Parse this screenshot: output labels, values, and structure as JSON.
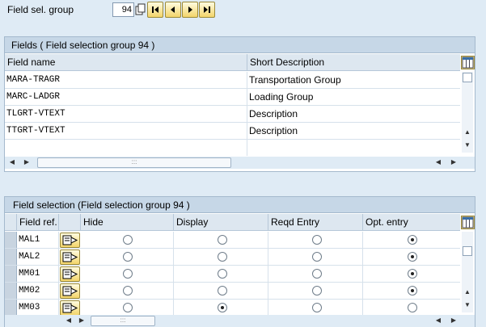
{
  "header": {
    "group_label": "Field sel. group",
    "group_value": "94"
  },
  "fields_table": {
    "title": "Fields  ( Field selection group  94 )",
    "columns": [
      "Field name",
      "Short Description"
    ],
    "rows": [
      {
        "name": "MARA-TRAGR",
        "desc": "Transportation Group"
      },
      {
        "name": "MARC-LADGR",
        "desc": "Loading Group"
      },
      {
        "name": "TLGRT-VTEXT",
        "desc": "Description"
      },
      {
        "name": "TTGRT-VTEXT",
        "desc": "Description"
      }
    ]
  },
  "selection_table": {
    "title": "Field selection (Field selection group  94 )",
    "columns": [
      "Field ref.",
      "Hide",
      "Display",
      "Reqd Entry",
      "Opt. entry"
    ],
    "rows": [
      {
        "ref": "MAL1",
        "selected": "Opt. entry"
      },
      {
        "ref": "MAL2",
        "selected": "Opt. entry"
      },
      {
        "ref": "MM01",
        "selected": "Opt. entry"
      },
      {
        "ref": "MM02",
        "selected": "Opt. entry"
      },
      {
        "ref": "MM03",
        "selected": "Display"
      }
    ]
  },
  "icons": {
    "copy": "copy-icon",
    "first": "first-page-icon",
    "prev": "previous-page-icon",
    "next": "next-page-icon",
    "last": "last-page-icon",
    "config": "table-settings-icon",
    "format": "field-format-icon"
  },
  "colors": {
    "background": "#dfebf5",
    "panel_title": "#c6d7e7",
    "button_yellow": "#f3d56a"
  }
}
